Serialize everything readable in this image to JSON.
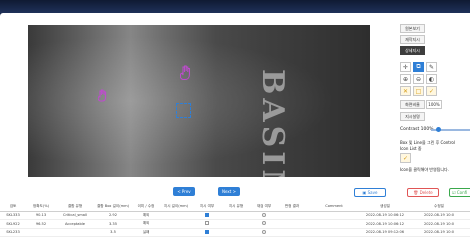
{
  "viewer": {
    "image_text": "BASIM 1"
  },
  "side": {
    "btn_original": "원본보기",
    "btn_request": "재작지시",
    "btn_detail": "상세지시",
    "rotation_label": "화면비율",
    "rotation_value": "100%",
    "instr_label": "지시설명",
    "contrast_label": "Contrast",
    "contrast_value": "100%",
    "hint1": "Box 및 Line을 그린 후 Control",
    "hint2": "Icon List 중",
    "hint3": "Icon을 클릭해야 반영됩니다."
  },
  "toolbar": {
    "prev": "< Prev",
    "next": "Next >",
    "save": "Save",
    "delete": "Delete",
    "confirm": "Confi"
  },
  "table": {
    "headers": [
      "검토",
      "정확도(%)",
      "결함 유형",
      "결함 Box 길이(mm)",
      "이미 / 수정",
      "지시 길이(mm)",
      "지시 여부",
      "지시 유형",
      "재검 여부",
      "판정 결과",
      "Comment",
      "생성일",
      "수정일"
    ],
    "rows": [
      [
        "SKL333",
        "90.13",
        "Critical_small",
        "2.92",
        "예외",
        "",
        "on",
        "",
        "",
        "",
        "",
        "2022-08-19 10:06:12",
        "2022-08-19 10:0"
      ],
      [
        "SKL922",
        "96.52",
        "Acceptable",
        "3.35",
        "예외",
        "",
        "off",
        "",
        "",
        "",
        "",
        "2022-08-19 10:06:12",
        "2022-08-19 10:0"
      ],
      [
        "SKL233",
        "",
        "",
        "3.5",
        "실패",
        "",
        "on",
        "",
        "",
        "",
        "",
        "2022-08-19 09:12:06",
        "2022-08-19 10:0"
      ]
    ]
  },
  "colors": {
    "accent": "#2f7fd6",
    "danger": "#e05555",
    "success": "#3aa84c",
    "marker": "#c04ad0"
  }
}
